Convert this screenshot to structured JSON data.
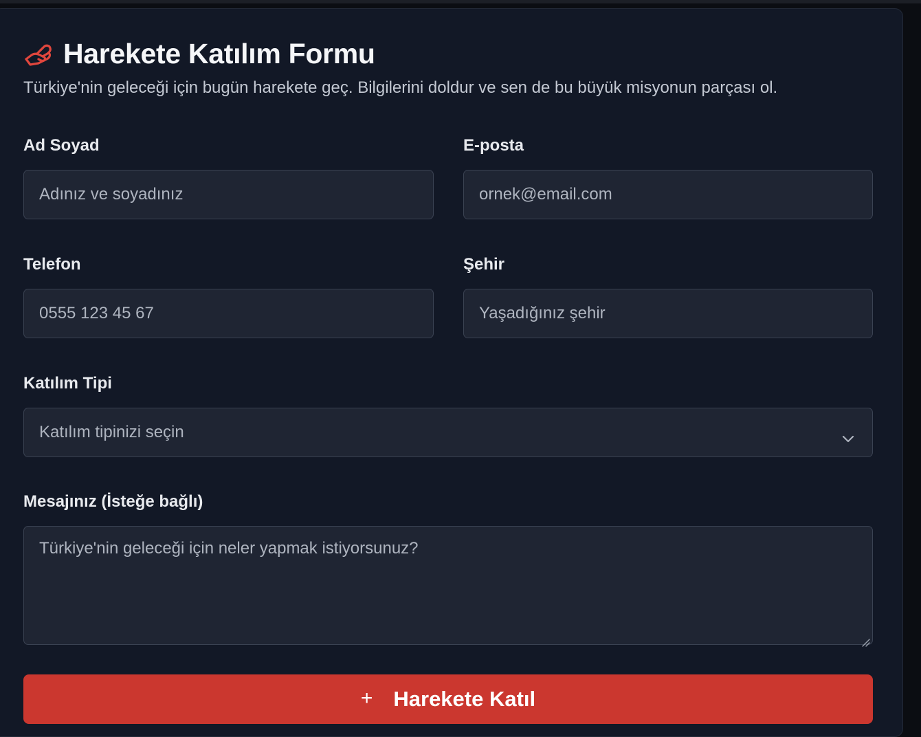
{
  "form": {
    "title": "Harekete Katılım Formu",
    "title_icon": "handshake-icon",
    "accent_color": "#cb372f",
    "subtitle": "Türkiye'nin geleceği için bugün harekete geç. Bilgilerini doldur ve sen de bu büyük misyonun parçası ol.",
    "fields": {
      "name": {
        "label": "Ad Soyad",
        "placeholder": "Adınız ve soyadınız"
      },
      "email": {
        "label": "E-posta",
        "placeholder": "ornek@email.com"
      },
      "phone": {
        "label": "Telefon",
        "placeholder": "0555 123 45 67"
      },
      "city": {
        "label": "Şehir",
        "placeholder": "Yaşadığınız şehir"
      },
      "participation": {
        "label": "Katılım Tipi",
        "selected": "Katılım tipinizi seçin",
        "icon": "chevron-down-icon"
      },
      "message": {
        "label": "Mesajınız (İsteğe bağlı)",
        "placeholder": "Türkiye'nin geleceği için neler yapmak istiyorsunuz?"
      }
    },
    "submit": {
      "icon": "plus-icon",
      "label": "Harekete Katıl"
    }
  }
}
